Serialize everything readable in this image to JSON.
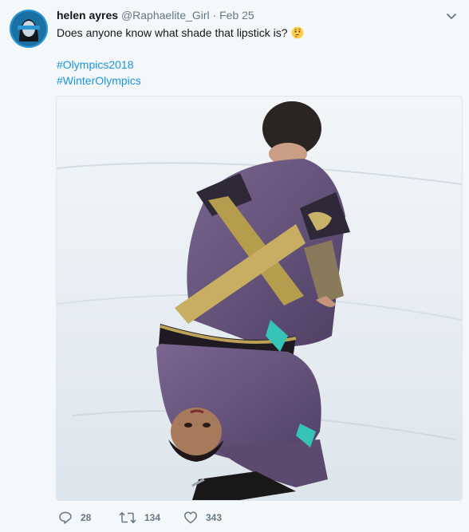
{
  "tweet": {
    "display_name": "helen ayres",
    "handle": "@Raphaelite_Girl",
    "separator": "·",
    "date": "Feb 25",
    "text": "Does anyone know what shade that lipstick is?",
    "emoji": "thinking-face-emoji",
    "hashtags": [
      "#Olympics2018",
      "#WinterOlympics"
    ]
  },
  "actions": {
    "reply_count": "28",
    "retweet_count": "134",
    "like_count": "343"
  },
  "colors": {
    "background": "#f5f8fa",
    "link": "#1b95e0",
    "secondary_text": "#657786"
  }
}
